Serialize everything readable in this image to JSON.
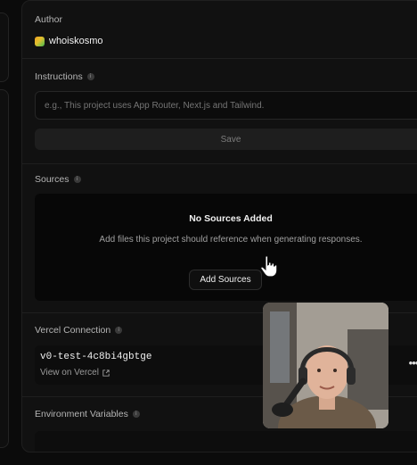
{
  "author": {
    "label": "Author",
    "username": "whoiskosmo"
  },
  "instructions": {
    "label": "Instructions",
    "placeholder": "e.g., This project uses App Router, Next.js and Tailwind.",
    "save_label": "Save"
  },
  "sources": {
    "label": "Sources",
    "empty_title": "No Sources Added",
    "empty_description": "Add files this project should reference when generating responses.",
    "add_button_label": "Add Sources"
  },
  "vercel_connection": {
    "label": "Vercel Connection",
    "project_name": "v0-test-4c8bi4gbtge",
    "view_link_label": "View on Vercel",
    "more_label": "•••"
  },
  "environment_variables": {
    "label": "Environment Variables"
  },
  "icons": {
    "info": "info-icon",
    "external": "external-link-icon",
    "cursor": "hand-pointer-icon"
  },
  "colors": {
    "background": "#0b0b0b",
    "panel": "#111111",
    "text": "#e6e6e6",
    "muted": "#9a9a9a"
  }
}
